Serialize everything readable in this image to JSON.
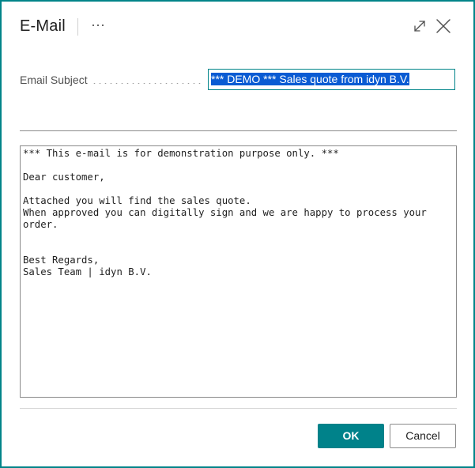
{
  "dialog": {
    "title": "E-Mail",
    "more_glyph": "···",
    "accent_color": "#008489",
    "icons": [
      "expand-icon",
      "close-icon"
    ]
  },
  "form": {
    "subject_label": "Email Subject",
    "subject_value": "*** DEMO *** Sales quote from idyn B.V.",
    "body_value": "*** This e-mail is for demonstration purpose only. ***\n\nDear customer,\n\nAttached you will find the sales quote.\nWhen approved you can digitally sign and we are happy to process your\norder.\n\n\nBest Regards,\nSales Team | idyn B.V."
  },
  "buttons": {
    "ok_label": "OK",
    "cancel_label": "Cancel"
  }
}
